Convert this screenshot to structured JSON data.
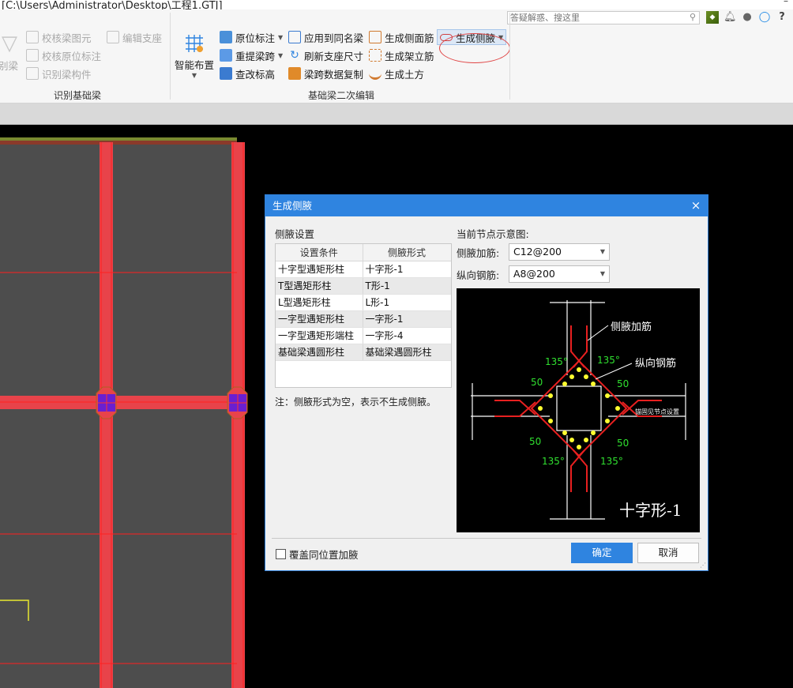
{
  "window": {
    "title_path": "[C:\\Users\\Administrator\\Desktop\\工程1.GTJ]",
    "minimize": "–"
  },
  "ribbon": {
    "search_placeholder": "答疑解惑、搜这里",
    "groups": [
      {
        "label": "识别基础梁",
        "items": [
          "校核梁图元",
          "编辑支座",
          "校核原位标注",
          "识别梁构件"
        ],
        "partial_left_label": "别梁"
      },
      {
        "label": "基础梁二次编辑",
        "big_button": "智能布置",
        "items": [
          "原位标注",
          "应用到同名梁",
          "生成侧面筋",
          "生成侧腋",
          "重提梁跨",
          "刷新支座尺寸",
          "生成架立筋",
          "查改标高",
          "梁跨数据复制",
          "生成土方"
        ]
      }
    ],
    "active_item": "生成侧腋"
  },
  "dialog": {
    "title": "生成侧腋",
    "close": "×",
    "section_left": "侧腋设置",
    "table": {
      "headers": [
        "设置条件",
        "侧腋形式"
      ],
      "rows": [
        [
          "十字型遇矩形柱",
          "十字形-1"
        ],
        [
          "T型遇矩形柱",
          "T形-1"
        ],
        [
          "L型遇矩形柱",
          "L形-1"
        ],
        [
          "一字型遇矩形柱",
          "一字形-1"
        ],
        [
          "一字型遇矩形端柱",
          "一字形-4"
        ],
        [
          "基础梁遇圆形柱",
          "基础梁遇圆形柱"
        ]
      ]
    },
    "note": "注：侧腋形式为空，表示不生成侧腋。",
    "section_right": "当前节点示意图:",
    "fields": [
      {
        "label": "侧腋加筋:",
        "value": "C12@200"
      },
      {
        "label": "纵向钢筋:",
        "value": "A8@200"
      }
    ],
    "diagram": {
      "label_side_rebar": "侧腋加筋",
      "label_long_rebar": "纵向钢筋",
      "angle": "135°",
      "len50": "50",
      "side_note": "锚固见节点设置",
      "caption": "十字形-1"
    },
    "checkbox": "覆盖同位置加腋",
    "ok": "确定",
    "cancel": "取消"
  },
  "colors": {
    "beam": "#e8434a",
    "column": "#6a1fd1",
    "slab": "#4a4a4a",
    "accent": "#2f84e0"
  }
}
